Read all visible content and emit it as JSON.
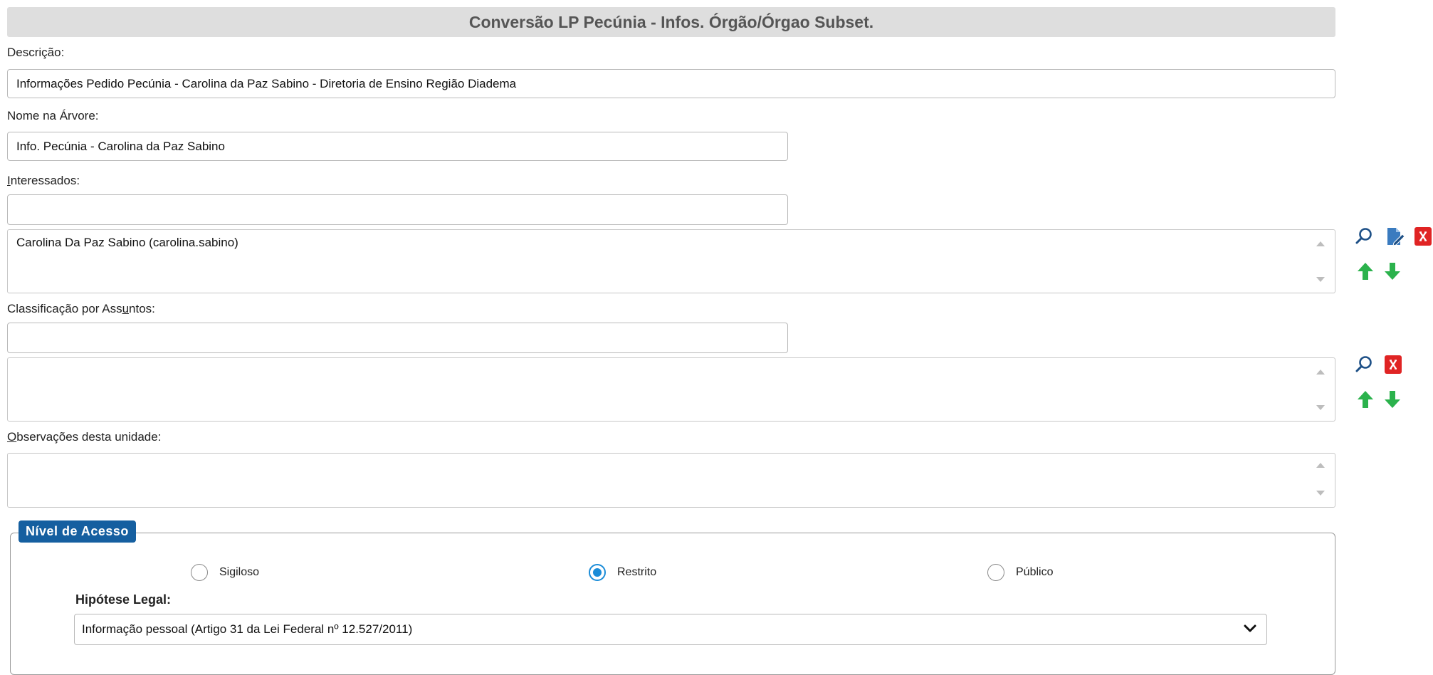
{
  "header": {
    "title": "Conversão LP Pecúnia - Infos. Órgão/Órgao Subset."
  },
  "descricao": {
    "label": "Descrição:",
    "value": "Informações Pedido Pecúnia - Carolina da Paz Sabino - Diretoria de Ensino Região Diadema"
  },
  "nome_arvore": {
    "label": "Nome na Árvore:",
    "value": "Info. Pecúnia - Carolina da Paz Sabino"
  },
  "interessados": {
    "label_first": "I",
    "label_rest": "nteressados:",
    "input_value": "",
    "items": [
      "Carolina Da Paz Sabino (carolina.sabino)"
    ]
  },
  "classificacao": {
    "label_before": "Classificação por Ass",
    "label_ul": "u",
    "label_after": "ntos:",
    "input_value": "",
    "items": []
  },
  "observacoes": {
    "label_first": "O",
    "label_rest": "bservações desta unidade:",
    "value": ""
  },
  "nivel_acesso": {
    "legend": "Nível de Acesso",
    "options": [
      {
        "label": "Sigiloso",
        "checked": false
      },
      {
        "label": "Restrito",
        "checked": true
      },
      {
        "label": "Público",
        "checked": false
      }
    ]
  },
  "hipotese_legal": {
    "label": "Hipótese Legal:",
    "selected": "Informação pessoal (Artigo 31 da Lei Federal nº 12.527/2011)"
  },
  "icons": {
    "search": "search-icon",
    "edit": "edit-icon",
    "remove": "remove-icon",
    "move_up": "arrow-up-icon",
    "move_down": "arrow-down-icon"
  },
  "colors": {
    "legend_bg": "#155fa0",
    "radio_checked": "#1a8cd8",
    "remove_red": "#e02424",
    "arrow_green": "#2bb24c",
    "edit_blue": "#3a7bbf"
  }
}
